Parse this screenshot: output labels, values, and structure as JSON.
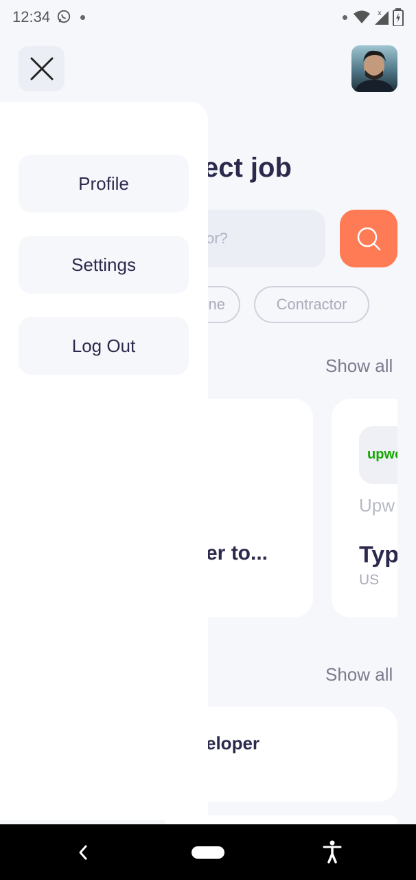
{
  "status_bar": {
    "time": "12:34",
    "icons": [
      "whatsapp-icon",
      "dot-icon",
      "wifi-icon",
      "signal-icon",
      "battery-icon"
    ]
  },
  "header": {
    "close_icon": "close-icon",
    "avatar": "user-avatar"
  },
  "background": {
    "title_partial": "ect job",
    "search_placeholder_partial": "or?",
    "search_icon": "search-icon",
    "chips": [
      "ne",
      "Contractor"
    ],
    "section1_show_all": "Show all",
    "section2_show_all": "Show all",
    "card1_title_partial": "er to...",
    "card2": {
      "logo_text": "upwo",
      "company": "Upw",
      "title": "Typ",
      "location": "US"
    },
    "card3_title_partial": "eloper"
  },
  "drawer": {
    "items": [
      {
        "label": "Profile"
      },
      {
        "label": "Settings"
      },
      {
        "label": "Log Out"
      }
    ]
  },
  "nav_bar": {
    "icons": [
      "back-icon",
      "home-pill",
      "accessibility-icon"
    ]
  },
  "colors": {
    "accent": "#ff7b55",
    "text_dark": "#2b2a4c",
    "background": "#f6f7fb",
    "upwork_green": "#14a800"
  }
}
